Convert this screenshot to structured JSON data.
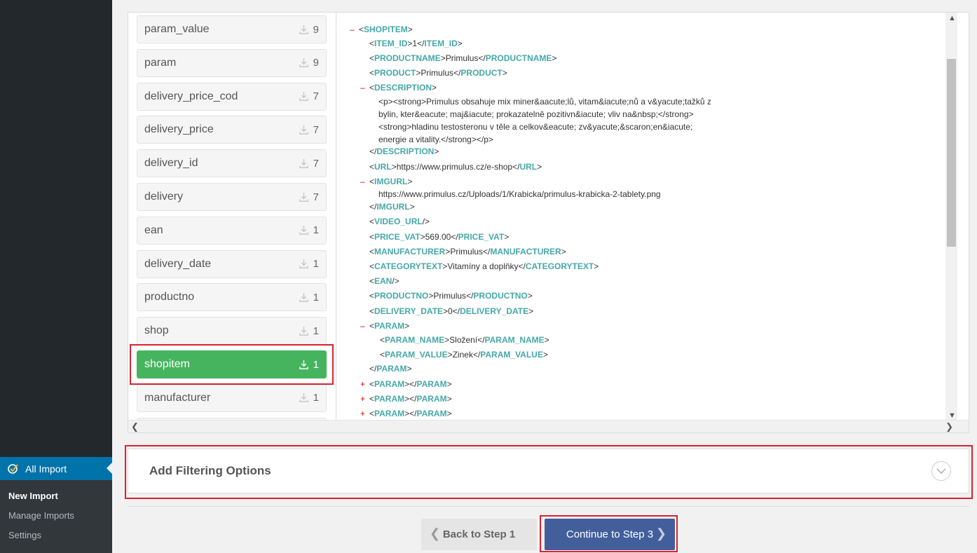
{
  "sidebar": {
    "all_import_label": "All Import",
    "submenu": [
      "New Import",
      "Manage Imports",
      "Settings"
    ]
  },
  "elements": [
    {
      "name": "param_value",
      "count": "9"
    },
    {
      "name": "param",
      "count": "9"
    },
    {
      "name": "delivery_price_cod",
      "count": "7"
    },
    {
      "name": "delivery_price",
      "count": "7"
    },
    {
      "name": "delivery_id",
      "count": "7"
    },
    {
      "name": "delivery",
      "count": "7"
    },
    {
      "name": "ean",
      "count": "1"
    },
    {
      "name": "delivery_date",
      "count": "1"
    },
    {
      "name": "productno",
      "count": "1"
    },
    {
      "name": "shop",
      "count": "1"
    },
    {
      "name": "shopitem",
      "count": "1"
    },
    {
      "name": "manufacturer",
      "count": "1"
    }
  ],
  "xml": {
    "shopitem": "SHOPITEM",
    "item_id": {
      "tag": "ITEM_ID",
      "value": "1"
    },
    "productname": {
      "tag": "PRODUCTNAME",
      "value": "Primulus"
    },
    "product": {
      "tag": "PRODUCT",
      "value": "Primulus"
    },
    "description": {
      "tag": "DESCRIPTION",
      "lines": [
        "<p><strong>Primulus obsahuje mix miner&aacute;lů, vitam&iacute;nů a v&yacute;tažků z",
        "bylin, kter&eacute; maj&iacute; prokazatelně pozitivn&iacute; vliv na&nbsp;</strong>",
        "<strong>hladinu testosteronu v těle a celkov&eacute; zv&yacute;&scaron;en&iacute;",
        "energie a vitality.</strong></p>"
      ]
    },
    "url": {
      "tag": "URL",
      "value": "https://www.primulus.cz/e-shop"
    },
    "imgurl": {
      "tag": "IMGURL",
      "value": "https://www.primulus.cz/Uploads/1/Krabicka/primulus-krabicka-2-tablety.png"
    },
    "video_url": "VIDEO_URL",
    "price_vat": {
      "tag": "PRICE_VAT",
      "value": "569.00"
    },
    "manufacturer": {
      "tag": "MANUFACTURER",
      "value": "Primulus"
    },
    "categorytext": {
      "tag": "CATEGORYTEXT",
      "value": "Vitamíny a doplňky"
    },
    "ean": "EAN",
    "productno": {
      "tag": "PRODUCTNO",
      "value": "Primulus"
    },
    "delivery_date": {
      "tag": "DELIVERY_DATE",
      "value": "0"
    },
    "param": "PARAM",
    "param_name": {
      "tag": "PARAM_NAME",
      "value": "Složení"
    },
    "param_value": {
      "tag": "PARAM_VALUE",
      "value": "Zinek"
    },
    "collapse_sign": "–",
    "expand_sign": "+"
  },
  "filter": {
    "title": "Add Filtering Options"
  },
  "buttons": {
    "back": "Back to Step 1",
    "continue": "Continue to Step 3"
  },
  "colors": {
    "active_element": "#46b45e",
    "continue_button": "#425f9c",
    "highlight": "#d9232e",
    "xml_tag": "#46a8a8",
    "admin_menu_active": "#0073aa"
  }
}
